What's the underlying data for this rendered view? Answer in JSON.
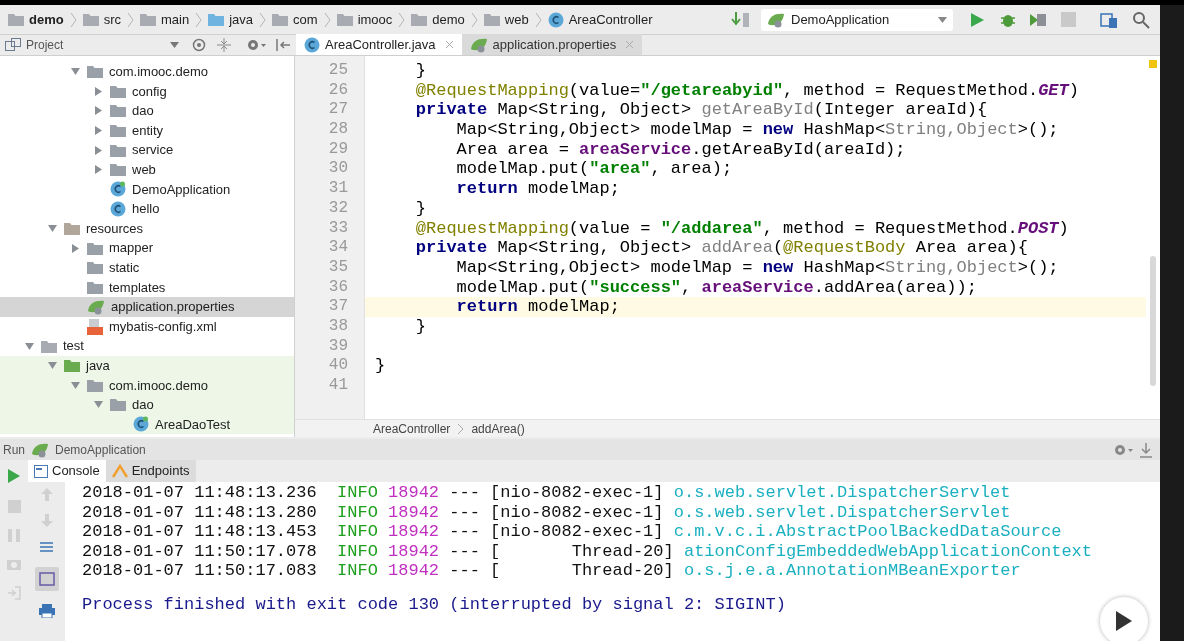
{
  "breadcrumbs": [
    {
      "label": "demo",
      "kind": "module"
    },
    {
      "label": "src",
      "kind": "folder"
    },
    {
      "label": "main",
      "kind": "folder"
    },
    {
      "label": "java",
      "kind": "source"
    },
    {
      "label": "com",
      "kind": "folder"
    },
    {
      "label": "imooc",
      "kind": "folder"
    },
    {
      "label": "demo",
      "kind": "folder"
    },
    {
      "label": "web",
      "kind": "folder"
    },
    {
      "label": "AreaController",
      "kind": "class"
    }
  ],
  "run_config": {
    "label": "DemoApplication"
  },
  "project_panel": {
    "title": "Project"
  },
  "editor_tabs": [
    {
      "label": "AreaController.java",
      "kind": "class",
      "selected": true
    },
    {
      "label": "application.properties",
      "kind": "properties",
      "selected": false
    }
  ],
  "tree": [
    {
      "children": [
        {
          "children": [
            {
              "label": "com.imooc.demo",
              "kind": "package",
              "expanded": true,
              "selected": false,
              "children": [
                {
                  "label": "config",
                  "kind": "package",
                  "expanded": false,
                  "selected": false
                },
                {
                  "label": "dao",
                  "kind": "package",
                  "expanded": false,
                  "selected": false
                },
                {
                  "label": "entity",
                  "kind": "package",
                  "expanded": false,
                  "selected": false
                },
                {
                  "label": "service",
                  "kind": "package",
                  "expanded": false,
                  "selected": false
                },
                {
                  "label": "web",
                  "kind": "package",
                  "expanded": false,
                  "selected": false
                },
                {
                  "label": "DemoApplication",
                  "kind": "spring-class",
                  "selected": false
                },
                {
                  "label": "hello",
                  "kind": "class",
                  "selected": false
                }
              ]
            }
          ]
        },
        {
          "label": "resources",
          "kind": "resources",
          "expanded": true,
          "selected": false,
          "children": [
            {
              "label": "mapper",
              "kind": "package",
              "expanded": false,
              "selected": false
            },
            {
              "label": "static",
              "kind": "package",
              "selected": false
            },
            {
              "label": "templates",
              "kind": "package",
              "selected": false
            },
            {
              "label": "application.properties",
              "kind": "properties",
              "selected": true
            },
            {
              "label": "mybatis-config.xml",
              "kind": "xml",
              "selected": false
            }
          ]
        }
      ]
    },
    {
      "label": "test",
      "kind": "folder",
      "expanded": true,
      "selected": false,
      "children": [
        {
          "label": "java",
          "kind": "test-source",
          "expanded": true,
          "selected": false,
          "children": [
            {
              "label": "com.imooc.demo",
              "kind": "package",
              "expanded": true,
              "selected": false,
              "children": [
                {
                  "label": "dao",
                  "kind": "package",
                  "expanded": true,
                  "selected": false,
                  "children": [
                    {
                      "label": "AreaDaoTest",
                      "kind": "test-class",
                      "selected": false
                    }
                  ]
                }
              ]
            }
          ]
        }
      ]
    }
  ],
  "code_lines": [
    {
      "number": "25",
      "current": false,
      "tokens": [
        {
          "kind": "plain",
          "text": "    }"
        }
      ]
    },
    {
      "number": "26",
      "current": false,
      "tokens": [
        {
          "kind": "annotation",
          "text": "    @RequestMapping"
        },
        {
          "kind": "plain",
          "text": "(value="
        },
        {
          "kind": "string",
          "text": "\"/getareabyid\""
        },
        {
          "kind": "plain",
          "text": ", method = RequestMethod."
        },
        {
          "kind": "constant",
          "text": "GET"
        },
        {
          "kind": "plain",
          "text": ")"
        }
      ]
    },
    {
      "number": "27",
      "current": false,
      "tokens": [
        {
          "kind": "keyword",
          "text": "    private"
        },
        {
          "kind": "plain",
          "text": " Map<String, Object> "
        },
        {
          "kind": "unused",
          "text": "getAreaById"
        },
        {
          "kind": "plain",
          "text": "(Integer areaId){"
        }
      ]
    },
    {
      "number": "28",
      "current": false,
      "tokens": [
        {
          "kind": "plain",
          "text": "        Map<String,Object> modelMap = "
        },
        {
          "kind": "keyword",
          "text": "new"
        },
        {
          "kind": "plain",
          "text": " HashMap<"
        },
        {
          "kind": "unused",
          "text": "String,Object"
        },
        {
          "kind": "plain",
          "text": ">();"
        }
      ]
    },
    {
      "number": "29",
      "current": false,
      "tokens": [
        {
          "kind": "plain",
          "text": "        Area area = "
        },
        {
          "kind": "field",
          "text": "areaService"
        },
        {
          "kind": "plain",
          "text": ".getAreaById(areaId);"
        }
      ]
    },
    {
      "number": "30",
      "current": false,
      "tokens": [
        {
          "kind": "plain",
          "text": "        modelMap.put("
        },
        {
          "kind": "string",
          "text": "\"area\""
        },
        {
          "kind": "plain",
          "text": ", area);"
        }
      ]
    },
    {
      "number": "31",
      "current": false,
      "tokens": [
        {
          "kind": "keyword",
          "text": "        return"
        },
        {
          "kind": "plain",
          "text": " modelMap;"
        }
      ]
    },
    {
      "number": "32",
      "current": false,
      "tokens": [
        {
          "kind": "plain",
          "text": "    }"
        }
      ]
    },
    {
      "number": "33",
      "current": false,
      "tokens": [
        {
          "kind": "annotation",
          "text": "    @RequestMapping"
        },
        {
          "kind": "plain",
          "text": "(value = "
        },
        {
          "kind": "string",
          "text": "\"/addarea\""
        },
        {
          "kind": "plain",
          "text": ", method = RequestMethod."
        },
        {
          "kind": "constant",
          "text": "POST"
        },
        {
          "kind": "plain",
          "text": ")"
        }
      ]
    },
    {
      "number": "34",
      "current": false,
      "tokens": [
        {
          "kind": "keyword",
          "text": "    private"
        },
        {
          "kind": "plain",
          "text": " Map<String, Object> "
        },
        {
          "kind": "unused",
          "text": "addArea"
        },
        {
          "kind": "plain",
          "text": "("
        },
        {
          "kind": "annotation",
          "text": "@RequestBody"
        },
        {
          "kind": "plain",
          "text": " Area area){"
        }
      ]
    },
    {
      "number": "35",
      "current": false,
      "tokens": [
        {
          "kind": "plain",
          "text": "        Map<String,Object> modelMap = "
        },
        {
          "kind": "keyword",
          "text": "new"
        },
        {
          "kind": "plain",
          "text": " HashMap<"
        },
        {
          "kind": "unused",
          "text": "String,Object"
        },
        {
          "kind": "plain",
          "text": ">();"
        }
      ]
    },
    {
      "number": "36",
      "current": false,
      "tokens": [
        {
          "kind": "plain",
          "text": "        modelMap.put("
        },
        {
          "kind": "string",
          "text": "\"success\""
        },
        {
          "kind": "plain",
          "text": ", "
        },
        {
          "kind": "field",
          "text": "areaService"
        },
        {
          "kind": "plain",
          "text": ".addArea(area));"
        }
      ]
    },
    {
      "number": "37",
      "current": true,
      "tokens": [
        {
          "kind": "keyword",
          "text": "        return"
        },
        {
          "kind": "plain",
          "text": " modelMap;"
        }
      ]
    },
    {
      "number": "38",
      "current": false,
      "tokens": [
        {
          "kind": "plain",
          "text": "    }"
        }
      ]
    },
    {
      "number": "39",
      "current": false
    },
    {
      "number": "40",
      "current": false,
      "tokens": [
        {
          "kind": "plain",
          "text": "}"
        }
      ]
    },
    {
      "number": "41",
      "current": false
    }
  ],
  "editor_breadcrumbs": [
    "AreaController",
    "addArea()"
  ],
  "run_bar": {
    "label": "Run",
    "config": "DemoApplication"
  },
  "console_tabs": [
    {
      "label": "Console",
      "kind": "console",
      "selected": true
    },
    {
      "label": "Endpoints",
      "kind": "endpoints",
      "selected": false
    }
  ],
  "console_lines": [
    {
      "timestamp": "2018-01-07 11:48:13.236",
      "level": "INFO",
      "pid": "18942",
      "separator": "---",
      "thread": "[nio-8082-exec-1]",
      "logger": "o.s.web.servlet.DispatcherServlet"
    },
    {
      "timestamp": "2018-01-07 11:48:13.280",
      "level": "INFO",
      "pid": "18942",
      "separator": "---",
      "thread": "[nio-8082-exec-1]",
      "logger": "o.s.web.servlet.DispatcherServlet"
    },
    {
      "timestamp": "2018-01-07 11:48:13.453",
      "level": "INFO",
      "pid": "18942",
      "separator": "---",
      "thread": "[nio-8082-exec-1]",
      "logger": "c.m.v.c.i.AbstractPoolBackedDataSource"
    },
    {
      "timestamp": "2018-01-07 11:50:17.078",
      "level": "INFO",
      "pid": "18942",
      "separator": "---",
      "thread": "[       Thread-20]",
      "logger": "ationConfigEmbeddedWebApplicationContext"
    },
    {
      "timestamp": "2018-01-07 11:50:17.083",
      "level": "INFO",
      "pid": "18942",
      "separator": "---",
      "thread": "[       Thread-20]",
      "logger": "o.s.j.e.a.AnnotationMBeanExporter"
    }
  ],
  "process_message": "Process finished with exit code 130 (interrupted by signal 2: SIGINT)"
}
